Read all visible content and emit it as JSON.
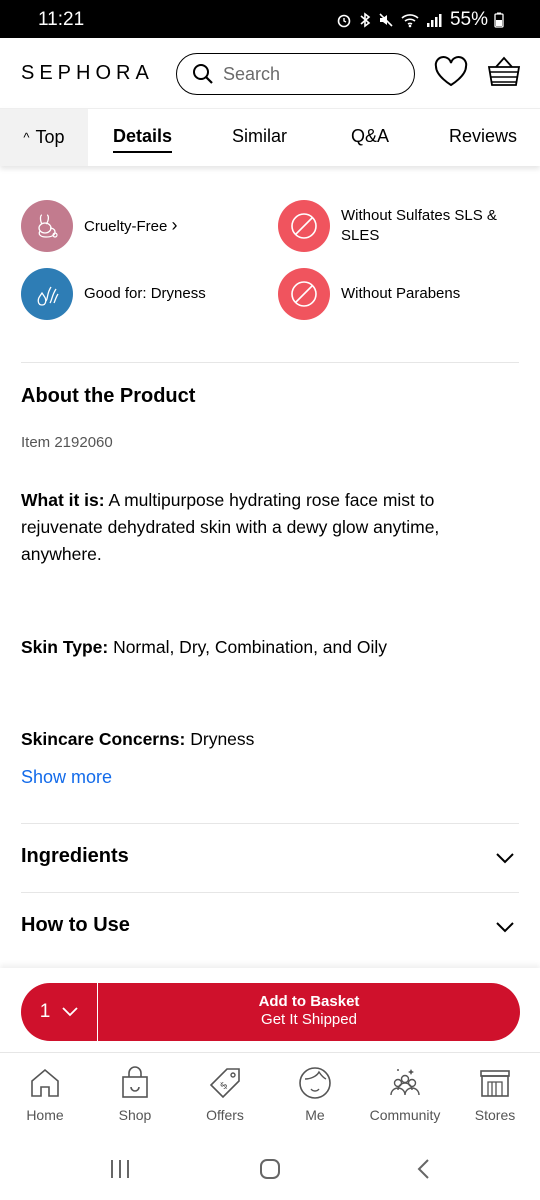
{
  "status_bar": {
    "time": "11:21",
    "battery": "55%"
  },
  "header": {
    "logo": "SEPHORA",
    "search_placeholder": "Search"
  },
  "tabs": {
    "top": "Top",
    "items": [
      "Details",
      "Similar",
      "Q&A",
      "Reviews"
    ],
    "active": "Details"
  },
  "highlights": [
    {
      "label": "Cruelty-Free",
      "chevron": "›",
      "icon": "bunny-icon",
      "color": "#c27b8e"
    },
    {
      "label": "Without Sulfates SLS & SLES",
      "icon": "prohibited-icon",
      "color": "#f0545e"
    },
    {
      "label": "Good for: Dryness",
      "icon": "water-drops-icon",
      "color": "#2e7db5"
    },
    {
      "label": "Without Parabens",
      "icon": "prohibited-icon",
      "color": "#f0545e"
    }
  ],
  "about": {
    "heading": "About the Product",
    "item": "Item 2192060",
    "what_it_is_label": "What it is:",
    "what_it_is_text": " A multipurpose hydrating rose face mist to rejuvenate dehydrated skin with a dewy glow anytime, anywhere.",
    "skin_type_label": "Skin Type:",
    "skin_type_text": " Normal, Dry, Combination, and Oily",
    "concerns_label": "Skincare Concerns:",
    "concerns_text": " Dryness",
    "show_more": "Show more"
  },
  "accordions": {
    "ingredients": "Ingredients",
    "how_to_use": "How to Use"
  },
  "basket": {
    "qty": "1",
    "line1": "Add to Basket",
    "line2": "Get It Shipped"
  },
  "bottom_nav": [
    "Home",
    "Shop",
    "Offers",
    "Me",
    "Community",
    "Stores"
  ],
  "colors": {
    "brand_red": "#cf112c",
    "link_blue": "#136bea"
  }
}
